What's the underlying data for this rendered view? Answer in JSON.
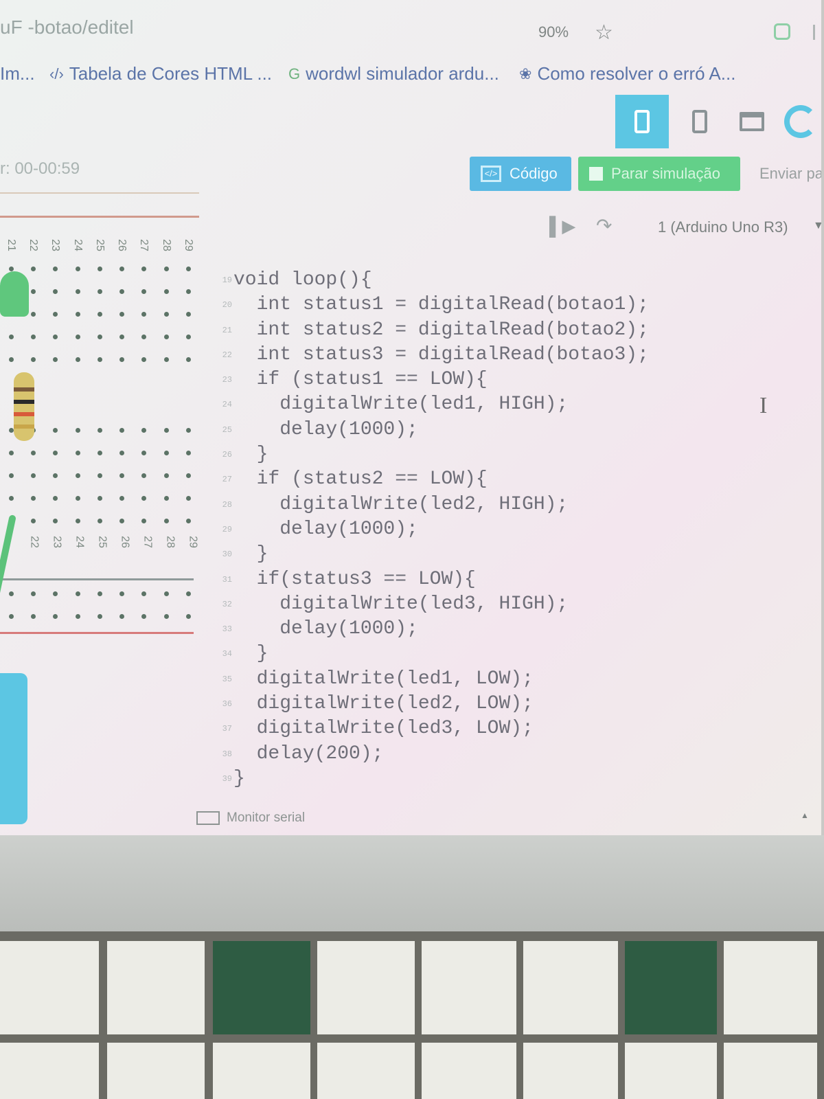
{
  "browser": {
    "url": "uF -botao/editel",
    "zoom": "90%",
    "star_icon": "star-icon",
    "bookmarks": [
      {
        "label": "Im...",
        "icon": "bookmark-icon"
      },
      {
        "label": "Tabela de Cores HTML ...",
        "icon": "code-icon"
      },
      {
        "label": "wordwl simulador ardu...",
        "icon": "google-icon"
      },
      {
        "label": "Como resolver o erró A...",
        "icon": "gear-icon"
      }
    ]
  },
  "simulator": {
    "timer": "r: 00-00:59",
    "code_button": "Código",
    "stop_button": "Parar simulação",
    "send_button": "Enviar par",
    "device": "1 (Arduino Uno R3)",
    "monitor_label": "Monitor serial",
    "column_numbers": [
      "21",
      "22",
      "23",
      "24",
      "25",
      "26",
      "27",
      "28",
      "29"
    ],
    "bottom_column_numbers": [
      "22",
      "23",
      "24",
      "25",
      "26",
      "27",
      "28",
      "29"
    ]
  },
  "code": {
    "lines": [
      "void loop(){",
      "  int status1 = digitalRead(botao1);",
      "  int status2 = digitalRead(botao2);",
      "  int status3 = digitalRead(botao3);",
      "  if (status1 == LOW){",
      "    digitalWrite(led1, HIGH);",
      "    delay(1000);",
      "  }",
      "  if (status2 == LOW){",
      "    digitalWrite(led2, HIGH);",
      "    delay(1000);",
      "  }",
      "  if(status3 == LOW){",
      "    digitalWrite(led3, HIGH);",
      "    delay(1000);",
      "  }",
      "  digitalWrite(led1, LOW);",
      "  digitalWrite(led2, LOW);",
      "  digitalWrite(led3, LOW);",
      "  delay(200);",
      "}"
    ]
  },
  "colors": {
    "accent_blue": "#5ab9e3",
    "accent_green": "#63d089"
  }
}
